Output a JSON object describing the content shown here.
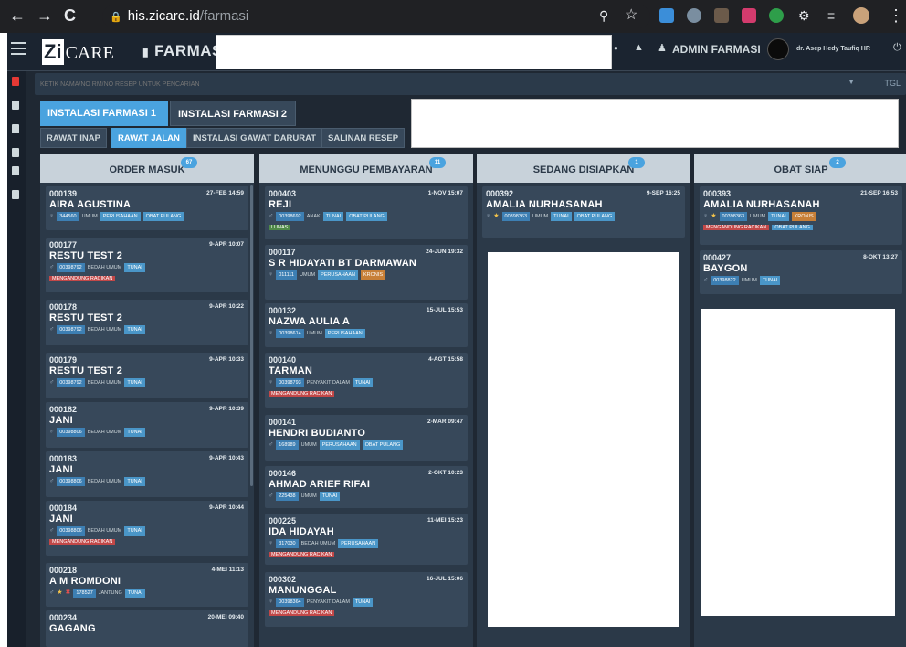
{
  "browser": {
    "url_host": "his.zicare.id",
    "url_path": "/farmasi",
    "back": "←",
    "forward": "→",
    "reload": "C"
  },
  "app": {
    "logo_zi": "Zi",
    "logo_care": "CARE",
    "module_title": "FARMASI",
    "user_role": "ADMIN FARMASI",
    "user_name": "dr. Asep Hedy Taufiq HR"
  },
  "search": {
    "placeholder": "KETIK NAMA/NO RM/NO RESEP UNTUK PENCARIAN",
    "date_label": "TGL"
  },
  "tabs_primary": [
    "INSTALASI FARMASI 1",
    "INSTALASI FARMASI 2"
  ],
  "tabs_secondary": [
    "RAWAT INAP",
    "RAWAT JALAN",
    "INSTALASI GAWAT DARURAT",
    "SALINAN RESEP"
  ],
  "columns": [
    {
      "title": "ORDER MASUK",
      "count": "67"
    },
    {
      "title": "MENUNGGU PEMBAYARAN",
      "count": "11"
    },
    {
      "title": "SEDANG DISIAPKAN",
      "count": "1"
    },
    {
      "title": "OBAT SIAP",
      "count": "2"
    }
  ],
  "col1": [
    {
      "no": "000139",
      "dt": "27-FEB 14:59",
      "nm": "AIRA AGUSTINA",
      "g": "♀",
      "rm": "344560",
      "a": "UMUM",
      "b1": "PERUSAHAAN",
      "b2": "OBAT PULANG"
    },
    {
      "no": "000177",
      "dt": "9-APR 10:07",
      "nm": "RESTU TEST 2",
      "g": "♂",
      "rm": "00398792",
      "a": "BEDAH UMUM",
      "b1": "TUNAI",
      "r": "MENGANDUNG RACIKAN"
    },
    {
      "no": "000178",
      "dt": "9-APR 10:22",
      "nm": "RESTU TEST 2",
      "g": "♂",
      "rm": "00398792",
      "a": "BEDAH UMUM",
      "b1": "TUNAI"
    },
    {
      "no": "000179",
      "dt": "9-APR 10:33",
      "nm": "RESTU TEST 2",
      "g": "♂",
      "rm": "00398792",
      "a": "BEDAH UMUM",
      "b1": "TUNAI"
    },
    {
      "no": "000182",
      "dt": "9-APR 10:39",
      "nm": "JANI",
      "g": "♂",
      "rm": "00398806",
      "a": "BEDAH UMUM",
      "b1": "TUNAI"
    },
    {
      "no": "000183",
      "dt": "9-APR 10:43",
      "nm": "JANI",
      "g": "♂",
      "rm": "00398806",
      "a": "BEDAH UMUM",
      "b1": "TUNAI"
    },
    {
      "no": "000184",
      "dt": "9-APR 10:44",
      "nm": "JANI",
      "g": "♂",
      "rm": "00398806",
      "a": "BEDAH UMUM",
      "b1": "TUNAI",
      "r": "MENGANDUNG RACIKAN"
    },
    {
      "no": "000218",
      "dt": "4-MEI 11:13",
      "nm": "A M ROMDONI",
      "g": "♂",
      "rm": "178527",
      "a": "JANTUNG",
      "b1": "TUNAI"
    },
    {
      "no": "000234",
      "dt": "20-MEI 09:40",
      "nm": "GAGANG"
    }
  ],
  "col2": [
    {
      "no": "000403",
      "dt": "1-NOV 15:07",
      "nm": "REJI",
      "g": "♂",
      "rm": "00398692",
      "a": "ANAK",
      "b1": "TUNAI",
      "b2": "OBAT PULANG",
      "l": "LUNAS"
    },
    {
      "no": "000117",
      "dt": "24-JUN 19:32",
      "nm": "S R HIDAYATI BT DARMAWAN",
      "g": "♀",
      "rm": "011111",
      "a": "UMUM",
      "b1": "PERUSAHAAN",
      "k": "KRONIS"
    },
    {
      "no": "000132",
      "dt": "15-JUL 15:53",
      "nm": "NAZWA AULIA A",
      "g": "♀",
      "rm": "00398614",
      "a": "UMUM",
      "b1": "PERUSAHAAN"
    },
    {
      "no": "000140",
      "dt": "4-AGT 15:58",
      "nm": "TARMAN",
      "g": "♀",
      "rm": "00398793",
      "a": "PENYAKIT DALAM",
      "b1": "TUNAI",
      "r": "MENGANDUNG RACIKAN"
    },
    {
      "no": "000141",
      "dt": "2-MAR 09:47",
      "nm": "HENDRI BUDIANTO",
      "g": "♂",
      "rm": "168989",
      "a": "UMUM",
      "b1": "PERUSAHAAN",
      "b2": "OBAT PULANG"
    },
    {
      "no": "000146",
      "dt": "2-OKT 10:23",
      "nm": "AHMAD ARIEF RIFAI",
      "g": "♂",
      "rm": "225438",
      "a": "UMUM",
      "b1": "TUNAI"
    },
    {
      "no": "000225",
      "dt": "11-MEI 15:23",
      "nm": "IDA HIDAYAH",
      "g": "♀",
      "rm": "317030",
      "a": "BEDAH UMUM",
      "b1": "PERUSAHAAN",
      "r": "MENGANDUNG RACIKAN"
    },
    {
      "no": "000302",
      "dt": "16-JUL 15:06",
      "nm": "MANUNGGAL",
      "g": "♀",
      "rm": "00398364",
      "a": "PENYAKIT DALAM",
      "b1": "TUNAI",
      "r": "MENGANDUNG RACIKAN"
    }
  ],
  "col3": [
    {
      "no": "000392",
      "dt": "9-SEP 16:25",
      "nm": "AMALIA NURHASANAH",
      "g": "♀",
      "rm": "00398363",
      "a": "UMUM",
      "b1": "TUNAI",
      "b2": "OBAT PULANG"
    }
  ],
  "col4": [
    {
      "no": "000393",
      "dt": "21-SEP 16:53",
      "nm": "AMALIA NURHASANAH",
      "g": "♀",
      "rm": "00398363",
      "a": "UMUM",
      "b1": "TUNAI",
      "k": "KRONIS",
      "r": "MENGANDUNG RACIKAN",
      "b3": "OBAT PULANG"
    },
    {
      "no": "000427",
      "dt": "8-OKT 13:27",
      "nm": "BAYGON",
      "g": "♂",
      "rm": "00398822",
      "a": "UMUM",
      "b1": "TUNAI"
    }
  ]
}
